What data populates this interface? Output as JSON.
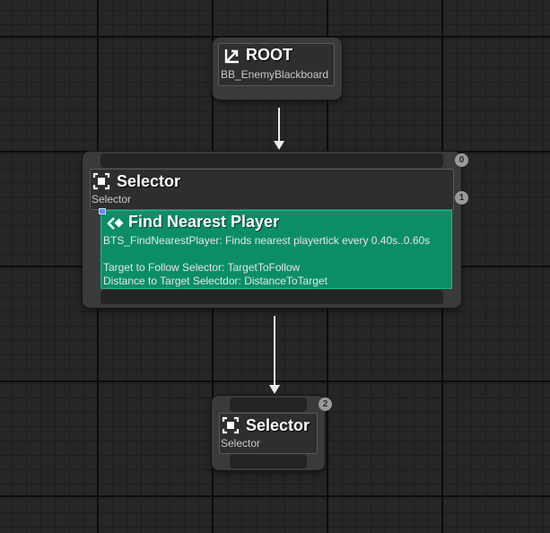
{
  "root_node": {
    "title": "ROOT",
    "subtitle": "BB_EnemyBlackboard",
    "icon": "root-arrow-icon"
  },
  "selector_main": {
    "title": "Selector",
    "subtitle": "Selector",
    "icon": "selector-icon",
    "exec_index": "0",
    "service_index": "1",
    "service": {
      "title": "Find Nearest Player",
      "icon": "service-icon",
      "description": "BTS_FindNearestPlayer: Finds nearest playertick every 0.40s..0.60s",
      "line_target": "Target to Follow Selector: TargetToFollow",
      "line_distance": "Distance to Target Selectdor: DistanceToTarget",
      "color": "#0b8e68"
    }
  },
  "selector_child": {
    "title": "Selector",
    "subtitle": "Selector",
    "icon": "selector-icon",
    "exec_index": "2"
  }
}
